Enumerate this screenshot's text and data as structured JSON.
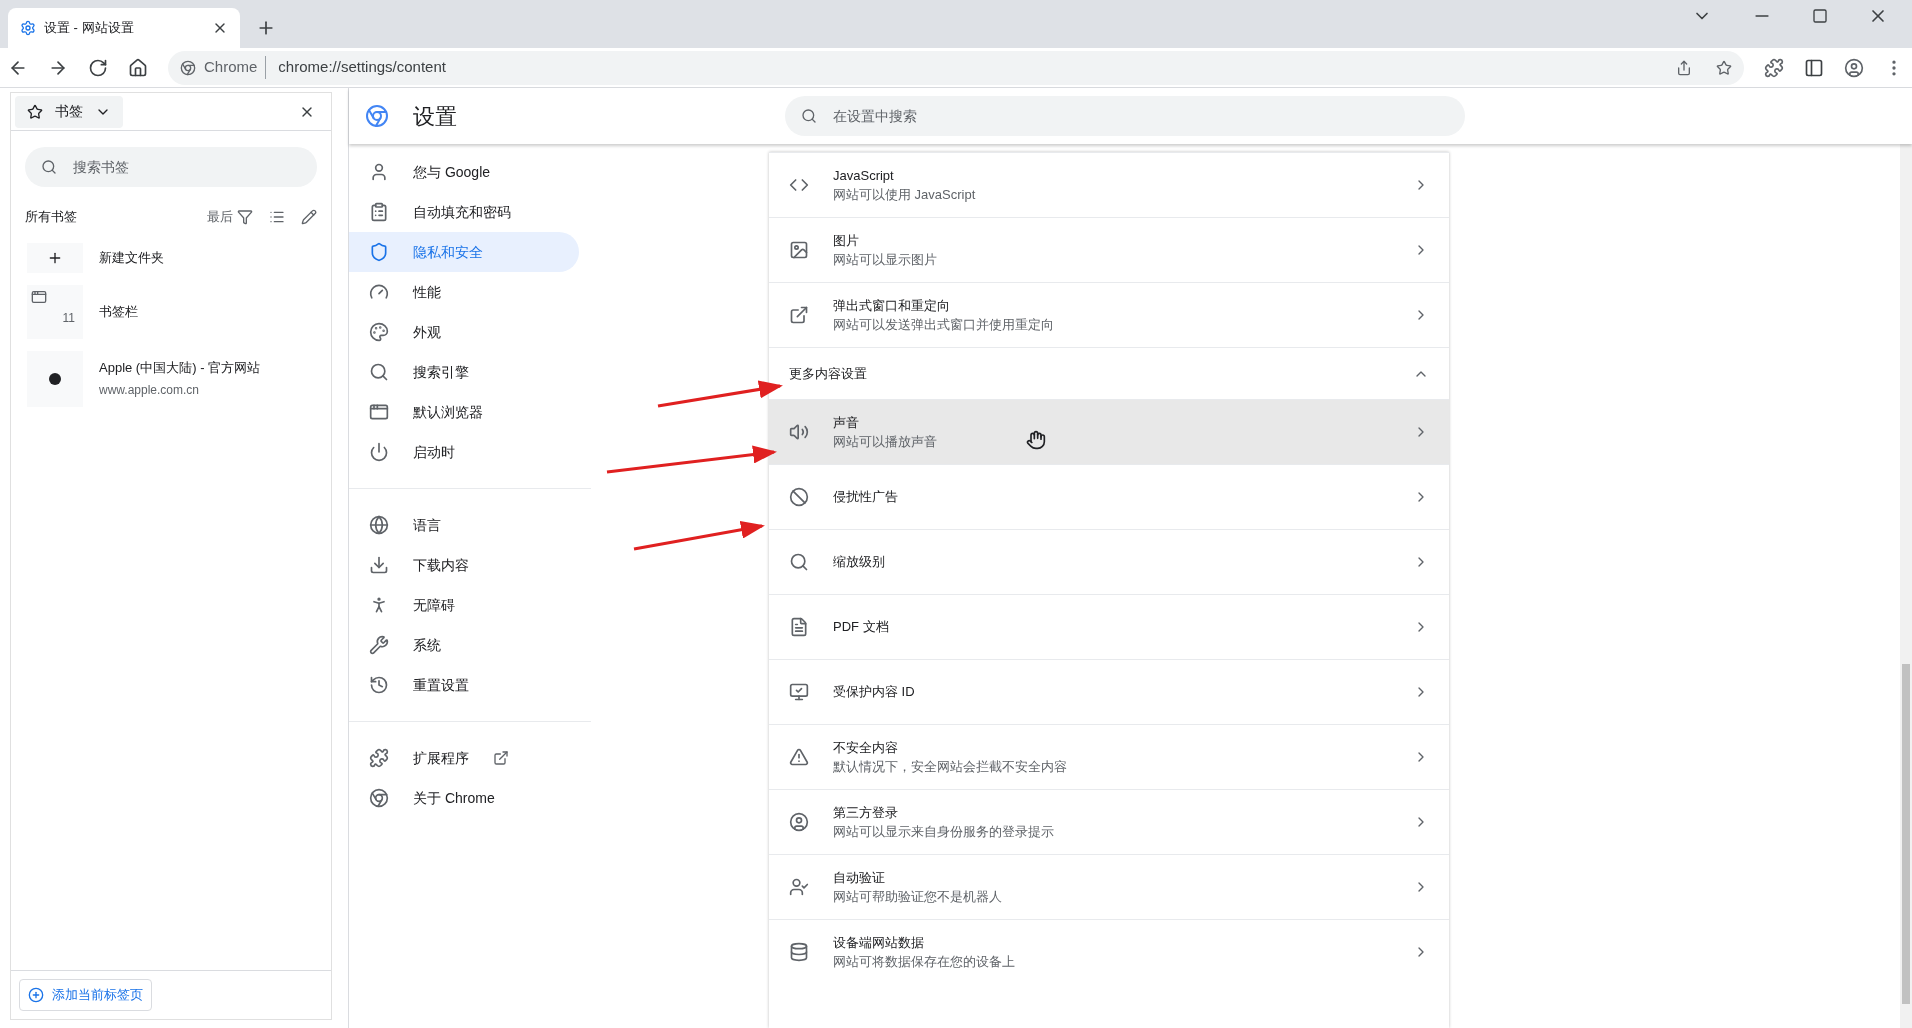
{
  "tab": {
    "title": "设置 - 网站设置",
    "selected": true
  },
  "address": {
    "site": "Chrome",
    "url": "chrome://settings/content"
  },
  "bookmarks": {
    "menu": "书签",
    "search": {
      "placeholder": "搜索书签"
    },
    "heading": "所有书签",
    "sort": "最后",
    "items": [
      {
        "kind": "new",
        "title": "新建文件夹"
      },
      {
        "kind": "folder",
        "title": "书签栏",
        "count": "11"
      },
      {
        "kind": "site",
        "title": "Apple (中国大陆) - 官方网站",
        "url": "www.apple.com.cn"
      }
    ],
    "add_button": "添加当前标签页"
  },
  "settings": {
    "title": "设置",
    "search": {
      "placeholder": "在设置中搜索"
    },
    "nav": [
      {
        "label": "您与 Google",
        "selected": false
      },
      {
        "label": "自动填充和密码",
        "selected": false
      },
      {
        "label": "隐私和安全",
        "selected": true
      },
      {
        "label": "性能",
        "selected": false
      },
      {
        "label": "外观",
        "selected": false
      },
      {
        "label": "搜索引擎",
        "selected": false
      },
      {
        "label": "默认浏览器",
        "selected": false
      },
      {
        "label": "启动时",
        "selected": false
      }
    ],
    "nav_advanced": [
      {
        "label": "语言",
        "selected": false
      },
      {
        "label": "下载内容",
        "selected": false
      },
      {
        "label": "无障碍",
        "selected": false
      },
      {
        "label": "系统",
        "selected": false
      },
      {
        "label": "重置设置",
        "selected": false
      }
    ],
    "nav_footer": [
      {
        "label": "扩展程序",
        "external": true
      },
      {
        "label": "关于 Chrome",
        "external": false
      }
    ],
    "rows_top": [
      {
        "title": "JavaScript",
        "subtitle": "网站可以使用 JavaScript",
        "hovered": false
      },
      {
        "title": "图片",
        "subtitle": "网站可以显示图片",
        "hovered": false
      },
      {
        "title": "弹出式窗口和重定向",
        "subtitle": "网站可以发送弹出式窗口并使用重定向",
        "hovered": false
      }
    ],
    "more_section": {
      "title": "更多内容设置",
      "expanded": true
    },
    "rows_more": [
      {
        "title": "声音",
        "subtitle": "网站可以播放声音",
        "hovered": true
      },
      {
        "title": "侵扰性广告",
        "hovered": false
      },
      {
        "title": "缩放级别",
        "hovered": false
      },
      {
        "title": "PDF 文档",
        "hovered": false
      },
      {
        "title": "受保护内容 ID",
        "hovered": false
      },
      {
        "title": "不安全内容",
        "subtitle": "默认情况下，安全网站会拦截不安全内容",
        "hovered": false
      },
      {
        "title": "第三方登录",
        "subtitle": "网站可以显示来自身份服务的登录提示",
        "hovered": false
      },
      {
        "title": "自动验证",
        "subtitle": "网站可帮助验证您不是机器人",
        "hovered": false
      },
      {
        "title": "设备端网站数据",
        "subtitle": "网站可将数据保存在您的设备上",
        "hovered": false
      }
    ]
  }
}
